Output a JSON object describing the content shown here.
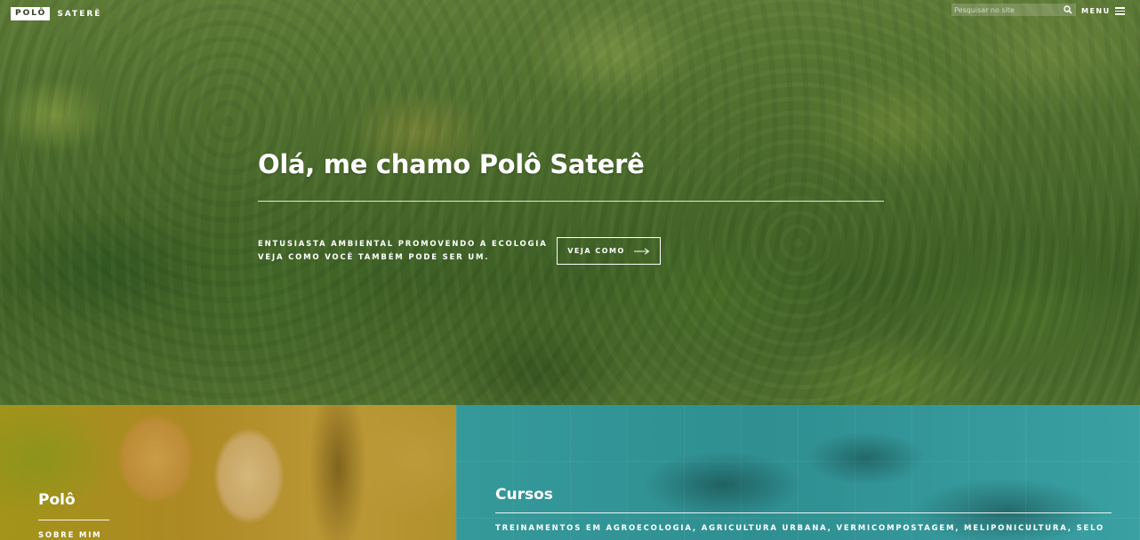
{
  "brand": {
    "logo_box": "POLÔ",
    "logo_text": "SATERÊ"
  },
  "search": {
    "placeholder": "Pesquisar no site"
  },
  "menu": {
    "label": "MENU"
  },
  "hero": {
    "title": "Olá, me chamo Polô Saterê",
    "subtitle_line1": "ENTUSIASTA AMBIENTAL PROMOVENDO A ECOLOGIA",
    "subtitle_line2": "VEJA COMO VOCÊ TAMBÉM PODE SER UM.",
    "cta_label": "VEJA COMO"
  },
  "panels": {
    "polo": {
      "title": "Polô",
      "link": "SOBRE MIM"
    },
    "cursos": {
      "title": "Cursos",
      "subtitle": "TREINAMENTOS EM AGROECOLOGIA, AGRICULTURA URBANA, VERMICOMPOSTAGEM, MELIPONICULTURA, SELO"
    }
  },
  "icons": {
    "search": "search-icon",
    "menu": "hamburger-icon",
    "arrow": "arrow-right-icon"
  },
  "colors": {
    "forest": "#4c6d2c",
    "teal": "#35999a",
    "gold": "#b58b2c"
  }
}
